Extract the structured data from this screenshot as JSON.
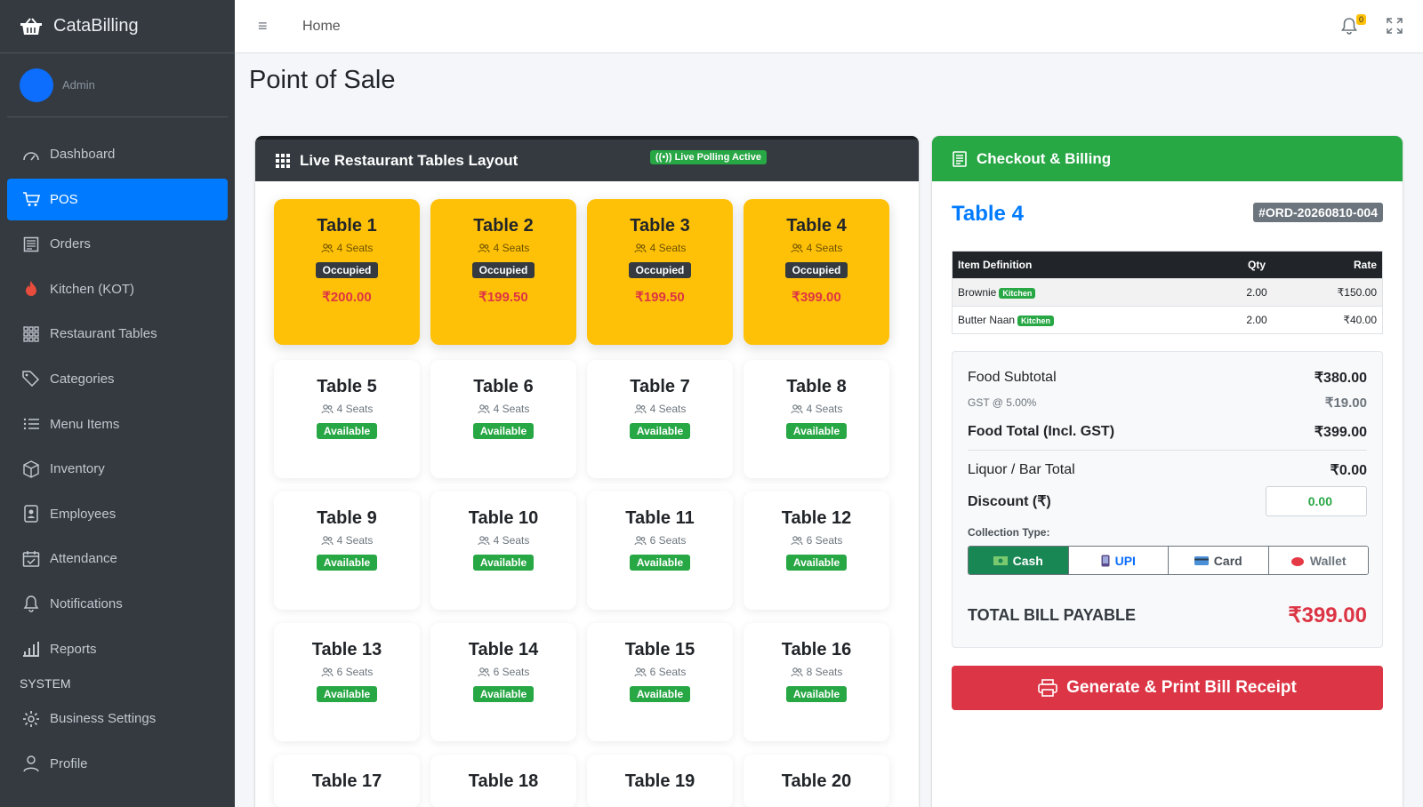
{
  "app": {
    "name": "CataBilling"
  },
  "user": {
    "name": "Admin"
  },
  "sidebar": {
    "items": [
      {
        "label": "Dashboard",
        "icon": "dashboard-icon"
      },
      {
        "label": "POS",
        "icon": "cart-icon",
        "active": true
      },
      {
        "label": "Orders",
        "icon": "orders-icon"
      },
      {
        "label": "Kitchen (KOT)",
        "icon": "flame-icon"
      },
      {
        "label": "Restaurant Tables",
        "icon": "grid-icon"
      },
      {
        "label": "Categories",
        "icon": "tags-icon"
      },
      {
        "label": "Menu Items",
        "icon": "list-icon"
      },
      {
        "label": "Inventory",
        "icon": "box-icon"
      },
      {
        "label": "Employees",
        "icon": "badge-icon"
      },
      {
        "label": "Attendance",
        "icon": "calendar-check-icon"
      },
      {
        "label": "Notifications",
        "icon": "bell-icon"
      },
      {
        "label": "Reports",
        "icon": "bar-chart-icon"
      }
    ],
    "section_header": "SYSTEM",
    "system_items": [
      {
        "label": "Business Settings",
        "icon": "gear-icon"
      },
      {
        "label": "Profile",
        "icon": "person-icon"
      }
    ]
  },
  "topbar": {
    "breadcrumb": "Home",
    "notification_count": "0"
  },
  "page": {
    "title": "Point of Sale"
  },
  "tables_panel": {
    "title": "Live Restaurant Tables Layout",
    "polling_badge": "Live Polling Active",
    "tables": [
      {
        "name": "Table 1",
        "seats": "4 Seats",
        "status": "Occupied",
        "amount": "₹200.00"
      },
      {
        "name": "Table 2",
        "seats": "4 Seats",
        "status": "Occupied",
        "amount": "₹199.50"
      },
      {
        "name": "Table 3",
        "seats": "4 Seats",
        "status": "Occupied",
        "amount": "₹199.50"
      },
      {
        "name": "Table 4",
        "seats": "4 Seats",
        "status": "Occupied",
        "amount": "₹399.00"
      },
      {
        "name": "Table 5",
        "seats": "4 Seats",
        "status": "Available"
      },
      {
        "name": "Table 6",
        "seats": "4 Seats",
        "status": "Available"
      },
      {
        "name": "Table 7",
        "seats": "4 Seats",
        "status": "Available"
      },
      {
        "name": "Table 8",
        "seats": "4 Seats",
        "status": "Available"
      },
      {
        "name": "Table 9",
        "seats": "4 Seats",
        "status": "Available"
      },
      {
        "name": "Table 10",
        "seats": "4 Seats",
        "status": "Available"
      },
      {
        "name": "Table 11",
        "seats": "6 Seats",
        "status": "Available"
      },
      {
        "name": "Table 12",
        "seats": "6 Seats",
        "status": "Available"
      },
      {
        "name": "Table 13",
        "seats": "6 Seats",
        "status": "Available"
      },
      {
        "name": "Table 14",
        "seats": "6 Seats",
        "status": "Available"
      },
      {
        "name": "Table 15",
        "seats": "6 Seats",
        "status": "Available"
      },
      {
        "name": "Table 16",
        "seats": "8 Seats",
        "status": "Available"
      },
      {
        "name": "Table 17"
      },
      {
        "name": "Table 18"
      },
      {
        "name": "Table 19"
      },
      {
        "name": "Table 20"
      }
    ]
  },
  "checkout": {
    "title": "Checkout & Billing",
    "selected_table": "Table 4",
    "order_number": "#ORD-20260810-004",
    "columns": {
      "item": "Item Definition",
      "qty": "Qty",
      "rate": "Rate"
    },
    "items": [
      {
        "name": "Brownie",
        "tag": "Kitchen",
        "qty": "2.00",
        "rate": "₹150.00"
      },
      {
        "name": "Butter Naan",
        "tag": "Kitchen",
        "qty": "2.00",
        "rate": "₹40.00"
      }
    ],
    "food_subtotal_label": "Food Subtotal",
    "food_subtotal": "₹380.00",
    "gst_label": "GST @ 5.00%",
    "gst_amount": "₹19.00",
    "food_total_label": "Food Total (Incl. GST)",
    "food_total": "₹399.00",
    "liquor_label": "Liquor / Bar Total",
    "liquor_total": "₹0.00",
    "discount_label": "Discount (₹)",
    "discount_value": "0.00",
    "collection_label": "Collection Type:",
    "payment_types": [
      "Cash",
      "UPI",
      "Card",
      "Wallet"
    ],
    "selected_payment": "Cash",
    "total_label": "TOTAL BILL PAYABLE",
    "total_amount": "₹399.00",
    "generate_button": "Generate & Print Bill Receipt"
  },
  "colors": {
    "accent": "#007bff",
    "success": "#28a745",
    "danger": "#dc3545",
    "warning": "#ffc107",
    "sidebar": "#343a40"
  }
}
